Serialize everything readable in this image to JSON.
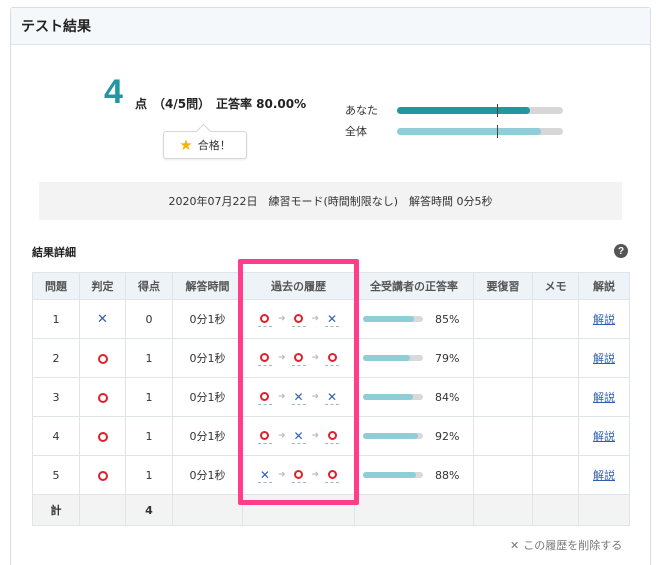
{
  "panel": {
    "title": "テスト結果"
  },
  "score": {
    "value": "4",
    "unit": "点",
    "count": "（4/5問）",
    "rate": "正答率 80.00%"
  },
  "badge": {
    "icon": "star-icon",
    "text": "合格！"
  },
  "compare": [
    {
      "label": "あなた",
      "fill": 0.8,
      "color": "#2296a3"
    },
    {
      "label": "全体",
      "fill": 0.87,
      "color": "#8fcdd7"
    }
  ],
  "info": "2020年07月22日　練習モード(時間制限なし)　解答時間 0分5秒",
  "detail": {
    "title": "結果詳細",
    "help_icon": "?"
  },
  "table": {
    "headers": [
      "問題",
      "判定",
      "得点",
      "解答時間",
      "過去の履歴",
      "全受講者の正答率",
      "要復習",
      "メモ",
      "解説"
    ],
    "rows": [
      {
        "no": "1",
        "judge": "x",
        "score": "0",
        "time": "0分1秒",
        "history": [
          "o",
          "o",
          "x"
        ],
        "rate": "85%",
        "rate_value": 0.85,
        "link": "解説"
      },
      {
        "no": "2",
        "judge": "o",
        "score": "1",
        "time": "0分1秒",
        "history": [
          "o",
          "o",
          "o"
        ],
        "rate": "79%",
        "rate_value": 0.79,
        "link": "解説"
      },
      {
        "no": "3",
        "judge": "o",
        "score": "1",
        "time": "0分1秒",
        "history": [
          "o",
          "x",
          "x"
        ],
        "rate": "84%",
        "rate_value": 0.84,
        "link": "解説"
      },
      {
        "no": "4",
        "judge": "o",
        "score": "1",
        "time": "0分1秒",
        "history": [
          "o",
          "x",
          "o"
        ],
        "rate": "92%",
        "rate_value": 0.92,
        "link": "解説"
      },
      {
        "no": "5",
        "judge": "o",
        "score": "1",
        "time": "0分1秒",
        "history": [
          "x",
          "o",
          "o"
        ],
        "rate": "88%",
        "rate_value": 0.88,
        "link": "解説"
      }
    ],
    "total_label": "計",
    "total_score": "4"
  },
  "delete_link": "この履歴を削除する",
  "colors": {
    "accent": "#2296a3",
    "highlight": "#ff3d8b",
    "correct": "#e0202a",
    "wrong": "#2f5fb0"
  }
}
